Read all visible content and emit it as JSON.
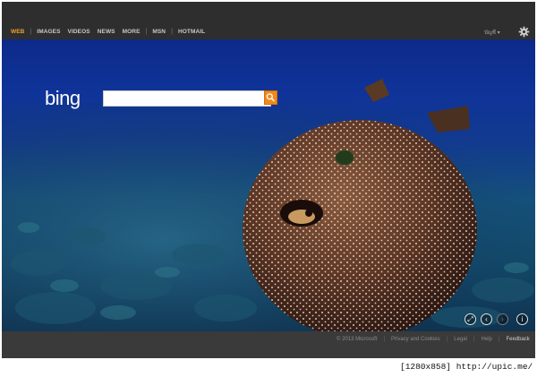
{
  "nav": {
    "items": [
      {
        "label": "WEB"
      },
      {
        "label": "IMAGES"
      },
      {
        "label": "VIDEOS"
      },
      {
        "label": "NEWS"
      },
      {
        "label": "MORE"
      },
      {
        "label": "MSN"
      },
      {
        "label": "HOTMAIL"
      }
    ],
    "lang_label": "บัญชี ▾"
  },
  "brand": {
    "logo": "bing",
    "accent": "#f0a030",
    "search_button_color": "#f08a1c"
  },
  "search": {
    "value": "",
    "placeholder": ""
  },
  "controls": {
    "icons": [
      "expand-icon",
      "previous-icon",
      "next-icon",
      "info-icon"
    ],
    "symbols": [
      "⤢",
      "‹",
      "›",
      "i"
    ]
  },
  "footer": {
    "copyright": "© 2013 Microsoft",
    "privacy": "Privacy and Cookies",
    "legal": "Legal",
    "help": "Help",
    "feedback": "Feedback"
  },
  "watermark": "[1280x858] http://upic.me/"
}
